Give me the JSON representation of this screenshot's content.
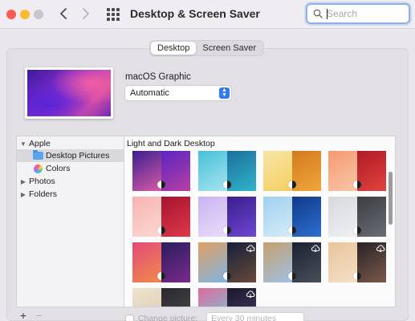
{
  "window": {
    "title": "Desktop & Screen Saver",
    "search_placeholder": "Search"
  },
  "tabs": [
    {
      "label": "Desktop",
      "active": true
    },
    {
      "label": "Screen Saver",
      "active": false
    }
  ],
  "current_wallpaper": {
    "name": "macOS Graphic",
    "mode": "Automatic"
  },
  "sidebar": {
    "items": [
      {
        "label": "Apple",
        "expanded": true
      },
      {
        "label": "Desktop Pictures",
        "selected": true,
        "icon": "folder-icon"
      },
      {
        "label": "Colors",
        "icon": "color-wheel-icon"
      },
      {
        "label": "Photos",
        "expanded": false
      },
      {
        "label": "Folders",
        "expanded": false
      }
    ]
  },
  "content": {
    "section_title": "Light and Dark Desktop",
    "thumbnails": [
      {
        "left": [
          "#3d1f8f",
          "#d65aa8"
        ],
        "right": [
          "#5a26c2",
          "#b83fa3"
        ],
        "indicator": "light-dark"
      },
      {
        "left": [
          "#46c0d8",
          "#a6e3f0"
        ],
        "right": [
          "#1e6f9c",
          "#2fb4c9"
        ],
        "indicator": "light-dark"
      },
      {
        "left": [
          "#f7e6a8",
          "#f4cf5f"
        ],
        "right": [
          "#d27a1f",
          "#f0a63a"
        ],
        "indicator": "light-dark"
      },
      {
        "left": [
          "#f49a72",
          "#f9c6a6"
        ],
        "right": [
          "#b01a27",
          "#e1443e"
        ],
        "indicator": "light-dark"
      },
      {
        "left": [
          "#f6b3b0",
          "#fbd8d4"
        ],
        "right": [
          "#a5142e",
          "#e0384a"
        ],
        "indicator": "light-dark"
      },
      {
        "left": [
          "#c9b4f0",
          "#e9dcfb"
        ],
        "right": [
          "#3a1e8c",
          "#6f46d4"
        ],
        "indicator": "light-dark"
      },
      {
        "left": [
          "#9ed0ef",
          "#d6ecf8"
        ],
        "right": [
          "#0f3a8a",
          "#2f6fd0"
        ],
        "indicator": "light-dark"
      },
      {
        "left": [
          "#d6d8dc",
          "#eef0f2"
        ],
        "right": [
          "#3a3c42",
          "#6b6e75"
        ],
        "indicator": "light-dark"
      },
      {
        "left": [
          "#e24a7a",
          "#f08a4a"
        ],
        "right": [
          "#2a1e5e",
          "#7a2a8c"
        ],
        "indicator": "light-dark"
      },
      {
        "left": [
          "#e0a064",
          "#7fb4e0"
        ],
        "right": [
          "#14203a",
          "#6a4a3a"
        ],
        "indicator": "light-dark",
        "cloud": true
      },
      {
        "left": [
          "#c4a070",
          "#a0c0e0"
        ],
        "right": [
          "#1a2230",
          "#4a4f5a"
        ],
        "indicator": "light-dark",
        "cloud": true
      },
      {
        "left": [
          "#e8c49a",
          "#f4e0c8"
        ],
        "right": [
          "#2a2228",
          "#7a5a4a"
        ],
        "indicator": "light-dark",
        "cloud": true
      },
      {
        "left": [
          "#f0e4d0",
          "#d8c8b0"
        ],
        "right": [
          "#2a2a2e",
          "#4a4a50"
        ],
        "indicator": "none"
      },
      {
        "left": [
          "#e06a9a",
          "#6ad0e0"
        ],
        "right": [
          "#1a1a2a",
          "#4a3a6a"
        ],
        "indicator": "none",
        "cloud": true
      }
    ]
  },
  "bottom": {
    "add_label": "+",
    "remove_label": "−",
    "change_picture_label": "Change picture:",
    "interval": "Every 30 minutes"
  }
}
